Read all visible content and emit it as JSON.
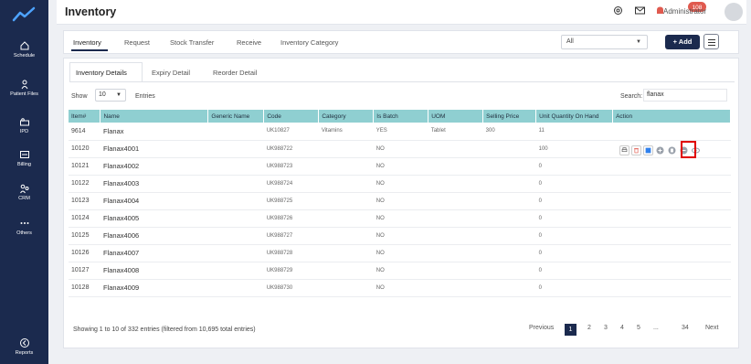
{
  "sidebar": {
    "items": [
      {
        "label": "Schedule",
        "icon": "home-icon"
      },
      {
        "label": "Patient Files",
        "icon": "user-outline-icon"
      },
      {
        "label": "IPD",
        "icon": "bed-icon"
      },
      {
        "label": "Billing",
        "icon": "billing-icon"
      },
      {
        "label": "CRM",
        "icon": "people-icon"
      },
      {
        "label": "Others",
        "icon": "more-icon"
      },
      {
        "label": "Reports",
        "icon": "reports-icon"
      }
    ]
  },
  "header": {
    "title": "Inventory",
    "notification_count": "108",
    "user": "Administrator"
  },
  "top_tabs": [
    "Inventory",
    "Request",
    "Stock Transfer",
    "Receive",
    "Inventory Category"
  ],
  "filter": {
    "value": "All"
  },
  "add_button": "+ Add",
  "sub_tabs": [
    "Inventory Details",
    "Expiry Detail",
    "Reorder Detail"
  ],
  "controls": {
    "show_label": "Show",
    "show_value": "10",
    "entries_label": "Entries",
    "search_label": "Search:",
    "search_value": "flanax"
  },
  "table": {
    "columns": [
      "Item#",
      "Name",
      "Generic Name",
      "Code",
      "Category",
      "Is Batch",
      "UOM",
      "Selling Price",
      "Unit Quantity On Hand",
      "Action"
    ],
    "rows": [
      [
        "9614",
        "Flanax",
        "",
        "UK10827",
        "Vitamins",
        "YES",
        "Tablet",
        "300",
        "11",
        ""
      ],
      [
        "10120",
        "Flanax4001",
        "",
        "UK988722",
        "",
        "NO",
        "",
        "",
        "100",
        ""
      ],
      [
        "10121",
        "Flanax4002",
        "",
        "UK988723",
        "",
        "NO",
        "",
        "",
        "0",
        ""
      ],
      [
        "10122",
        "Flanax4003",
        "",
        "UK988724",
        "",
        "NO",
        "",
        "",
        "0",
        ""
      ],
      [
        "10123",
        "Flanax4004",
        "",
        "UK988725",
        "",
        "NO",
        "",
        "",
        "0",
        ""
      ],
      [
        "10124",
        "Flanax4005",
        "",
        "UK988726",
        "",
        "NO",
        "",
        "",
        "0",
        ""
      ],
      [
        "10125",
        "Flanax4006",
        "",
        "UK988727",
        "",
        "NO",
        "",
        "",
        "0",
        ""
      ],
      [
        "10126",
        "Flanax4007",
        "",
        "UK988728",
        "",
        "NO",
        "",
        "",
        "0",
        ""
      ],
      [
        "10127",
        "Flanax4008",
        "",
        "UK988729",
        "",
        "NO",
        "",
        "",
        "0",
        ""
      ],
      [
        "10128",
        "Flanax4009",
        "",
        "UK988730",
        "",
        "NO",
        "",
        "",
        "0",
        ""
      ]
    ]
  },
  "footer": {
    "info": "Showing 1 to 10 of 332 entries (filtered from 10,695 total entries)",
    "previous": "Previous",
    "pages": [
      "1",
      "2",
      "3",
      "4",
      "5",
      "...",
      "34"
    ],
    "next": "Next"
  },
  "colors": {
    "sidebar": "#1b2a4e",
    "table_header": "#8fcfd1",
    "badge": "#e05a4f",
    "highlight": "#e00000"
  }
}
